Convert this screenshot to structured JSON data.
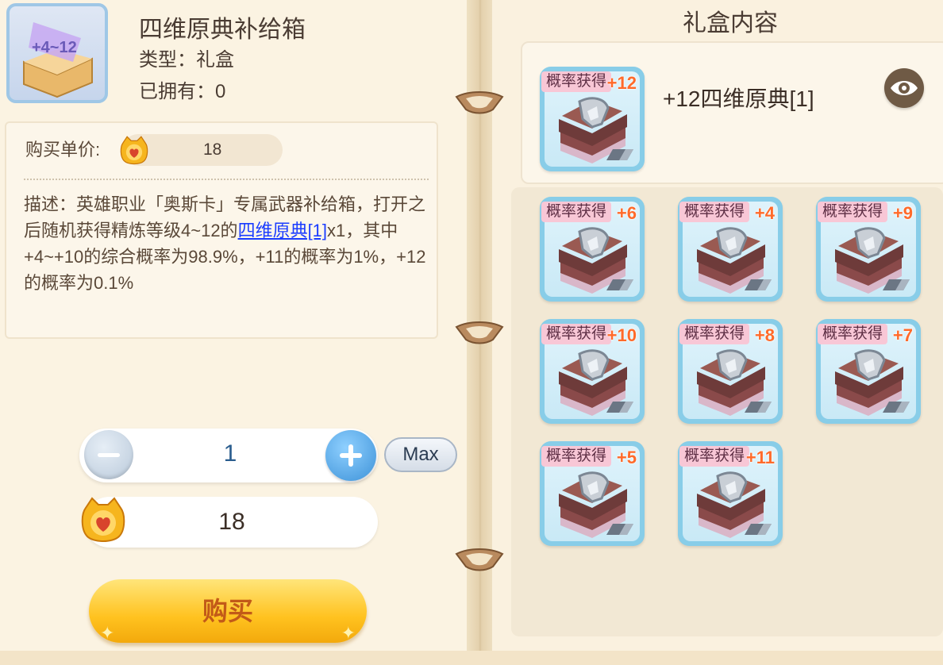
{
  "item": {
    "title": "四维原典补给箱",
    "type_label": "类型：礼盒",
    "owned_label": "已拥有：0",
    "icon_name": "gift-box-icon",
    "icon_text": "+4~12"
  },
  "purchase": {
    "unit_price_label": "购买单价:",
    "unit_price": "18",
    "description_prefix": "描述：英雄职业「奥斯卡」专属武器补给箱，打开之后随机获得精炼等级4~12的",
    "description_link": "四维原典[1]",
    "description_suffix": "x1，其中+4~+10的综合概率为98.9%，+11的概率为1%，+12的概率为0.1%",
    "quantity": "1",
    "max_label": "Max",
    "total": "18",
    "buy_label": "购买"
  },
  "gift_contents": {
    "title": "礼盒内容",
    "featured": {
      "tag": "概率获得",
      "level": "+12",
      "name": "+12四维原典[1]"
    },
    "items": [
      {
        "tag": "概率获得",
        "level": "+6"
      },
      {
        "tag": "概率获得",
        "level": "+4"
      },
      {
        "tag": "概率获得",
        "level": "+9"
      },
      {
        "tag": "概率获得",
        "level": "+10"
      },
      {
        "tag": "概率获得",
        "level": "+8"
      },
      {
        "tag": "概率获得",
        "level": "+7"
      },
      {
        "tag": "概率获得",
        "level": "+5"
      },
      {
        "tag": "概率获得",
        "level": "+11"
      }
    ]
  },
  "colors": {
    "accent_blue": "#3d92d8",
    "buy_gold": "#ffc21f",
    "tag_pink": "#f8c7d6",
    "level_orange": "#ff6a2a",
    "link_blue": "#1a3cff"
  }
}
